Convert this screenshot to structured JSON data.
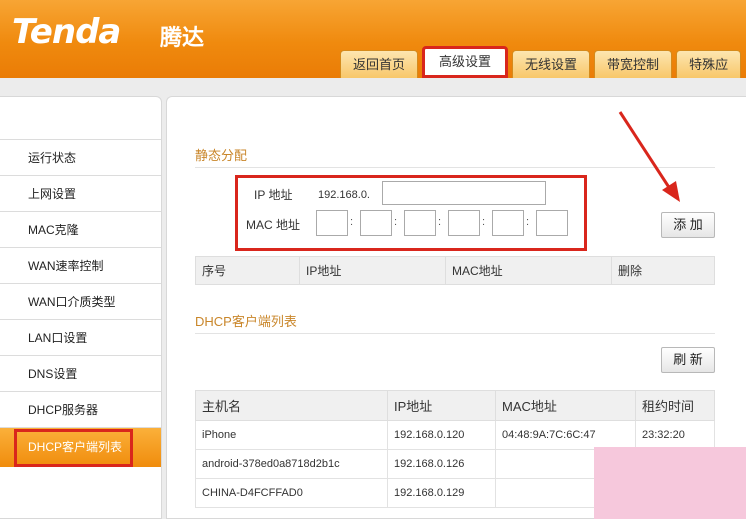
{
  "header": {
    "logo": "Tenda",
    "logo_cn": "腾达",
    "tabs": [
      {
        "label": "返回首页"
      },
      {
        "label": "高级设置"
      },
      {
        "label": "无线设置"
      },
      {
        "label": "带宽控制"
      },
      {
        "label": "特殊应"
      }
    ]
  },
  "sidebar": {
    "items": [
      {
        "label": "运行状态"
      },
      {
        "label": "上网设置"
      },
      {
        "label": "MAC克隆"
      },
      {
        "label": "WAN速率控制"
      },
      {
        "label": "WAN口介质类型"
      },
      {
        "label": "LAN口设置"
      },
      {
        "label": "DNS设置"
      },
      {
        "label": "DHCP服务器"
      },
      {
        "label": "DHCP客户端列表"
      }
    ]
  },
  "static": {
    "title": "静态分配",
    "ip_label": "IP 地址",
    "ip_prefix": "192.168.0.",
    "mac_label": "MAC 地址",
    "add_button": "添 加",
    "table_headers": [
      "序号",
      "IP地址",
      "MAC地址",
      "删除"
    ]
  },
  "dhcp_list": {
    "title": "DHCP客户端列表",
    "refresh_button": "刷 新",
    "headers": [
      "主机名",
      "IP地址",
      "MAC地址",
      "租约时间"
    ],
    "rows": [
      {
        "host": "iPhone",
        "ip": "192.168.0.120",
        "mac": "04:48:9A:7C:6C:47",
        "lease": "23:32:20"
      },
      {
        "host": "android-378ed0a8718d2b1c",
        "ip": "192.168.0.126",
        "mac": "",
        "lease": ""
      },
      {
        "host": "CHINA-D4FCFFAD0",
        "ip": "192.168.0.129",
        "mac": "",
        "lease": ""
      }
    ]
  },
  "colors": {
    "header_orange": "#f08a0e",
    "highlight_red": "#d9261c",
    "section_title": "#c9862a",
    "watermark_pink": "#f6c8dc"
  }
}
